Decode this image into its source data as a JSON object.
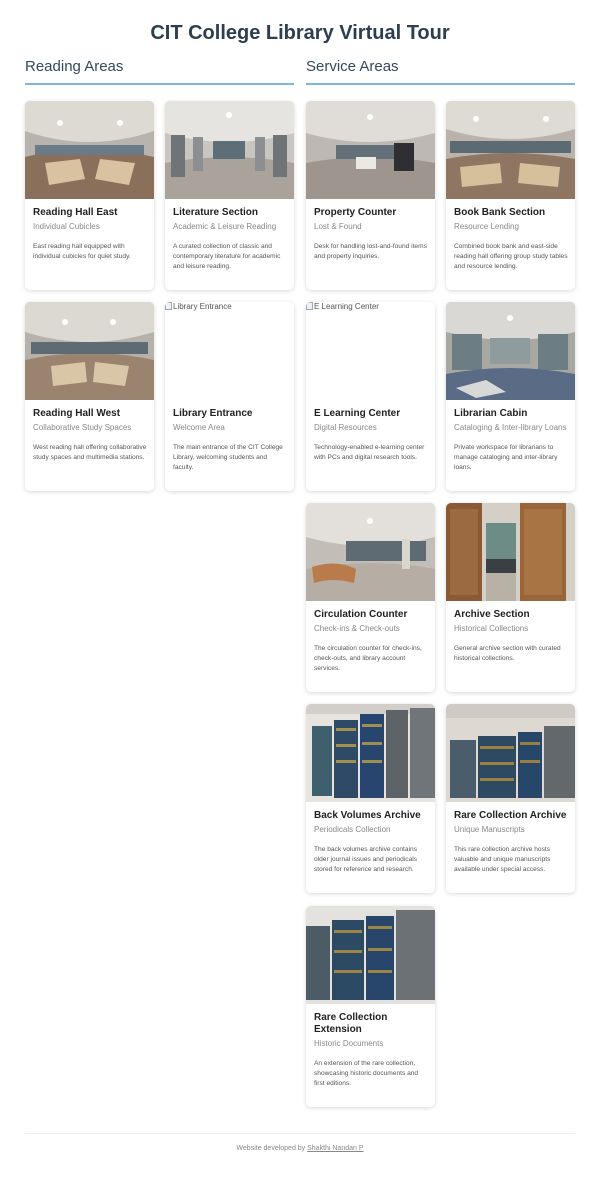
{
  "page": {
    "title": "CIT College Library Virtual Tour"
  },
  "sections": {
    "reading": {
      "title": "Reading Areas"
    },
    "service": {
      "title": "Service Areas"
    }
  },
  "reading_cards": [
    {
      "title": "Reading Hall East",
      "subtitle": "Individual Cubicles",
      "desc": "East reading hall equipped with individual cubicles for quiet study."
    },
    {
      "title": "Literature Section",
      "subtitle": "Academic & Leisure Reading",
      "desc": "A curated collection of classic and contemporary literature for academic and leisure reading."
    },
    {
      "title": "Reading Hall West",
      "subtitle": "Collaborative Study Spaces",
      "desc": "West reading hall offering collaborative study spaces and multimedia stations."
    },
    {
      "title": "Library Entrance",
      "subtitle": "Welcome Area",
      "desc": "The main entrance of the CIT College Library, welcoming students and faculty.",
      "img_alt": "Library Entrance"
    }
  ],
  "service_cards": [
    {
      "title": "Property Counter",
      "subtitle": "Lost & Found",
      "desc": "Desk for handling lost-and-found items and property inquiries."
    },
    {
      "title": "Book Bank Section",
      "subtitle": "Resource Lending",
      "desc": "Combined book bank and east-side reading hall offering group study tables and resource lending."
    },
    {
      "title": "E Learning Center",
      "subtitle": "Digital Resources",
      "desc": "Technology-enabled e-learning center with PCs and digital research tools.",
      "img_alt": "E Learning Center"
    },
    {
      "title": "Librarian Cabin",
      "subtitle": "Cataloging & Inter-library Loans",
      "desc": "Private workspace for librarians to manage cataloging and inter-library loans."
    },
    {
      "title": "Circulation Counter",
      "subtitle": "Check-ins & Check-outs",
      "desc": "The circulation counter for check-ins, check-outs, and library account services."
    },
    {
      "title": "Archive Section",
      "subtitle": "Historical Collections",
      "desc": "General archive section with curated historical collections."
    },
    {
      "title": "Back Volumes Archive",
      "subtitle": "Periodicals Collection",
      "desc": "The back volumes archive contains older journal issues and periodicals stored for reference and research."
    },
    {
      "title": "Rare Collection Archive",
      "subtitle": "Unique Manuscripts",
      "desc": "This rare collection archive hosts valuable and unique manuscripts available under special access."
    },
    {
      "title": "Rare Collection Extension",
      "subtitle": "Historic Documents",
      "desc": "An extension of the rare collection, showcasing historic documents and first editions."
    }
  ],
  "footer": {
    "prefix": "Website developed by",
    "author": "Shakthi Nandan P"
  },
  "colors": {
    "title": "#2c3e50",
    "accent_rule": "#7cb6df"
  }
}
